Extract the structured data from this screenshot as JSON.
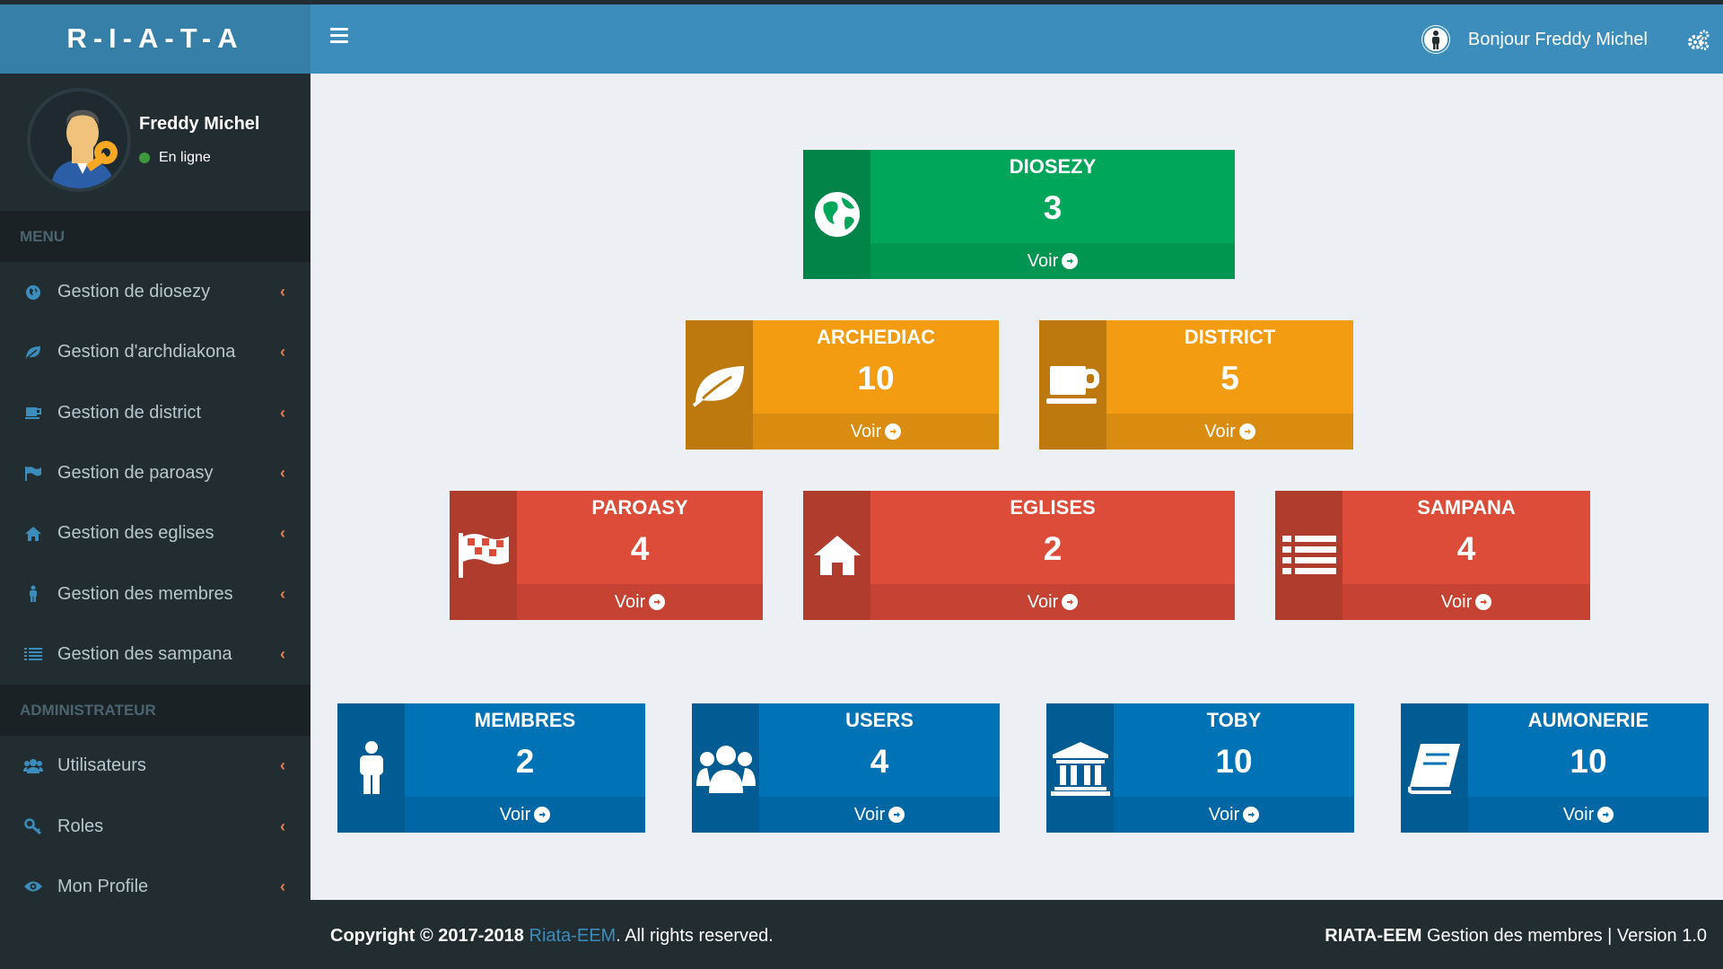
{
  "app": {
    "logo": "R-I-A-T-A"
  },
  "user": {
    "name": "Freddy Michel",
    "status": "En ligne"
  },
  "header": {
    "greeting": "Bonjour Freddy Michel"
  },
  "menu": {
    "section1": "MENU",
    "items": [
      {
        "label": "Gestion de diosezy",
        "icon": "globe-icon"
      },
      {
        "label": "Gestion d'archdiakona",
        "icon": "leaf-icon"
      },
      {
        "label": "Gestion de district",
        "icon": "coffee-icon"
      },
      {
        "label": "Gestion de paroasy",
        "icon": "flag-icon"
      },
      {
        "label": "Gestion des eglises",
        "icon": "home-icon"
      },
      {
        "label": "Gestion des membres",
        "icon": "male-icon"
      },
      {
        "label": "Gestion des sampana",
        "icon": "list-icon"
      }
    ],
    "section2": "ADMINISTRATEUR",
    "admin_items": [
      {
        "label": "Utilisateurs",
        "icon": "users-icon"
      },
      {
        "label": "Roles",
        "icon": "key-icon"
      },
      {
        "label": "Mon Profile",
        "icon": "eye-icon"
      }
    ]
  },
  "cards": [
    {
      "title": "DIOSEZY",
      "count": "3",
      "link": "Voir",
      "color": "#00a65a",
      "icon": "globe-icon"
    },
    {
      "title": "ARCHEDIAC",
      "count": "10",
      "link": "Voir",
      "color": "#f39c12",
      "icon": "leaf-icon"
    },
    {
      "title": "DISTRICT",
      "count": "5",
      "link": "Voir",
      "color": "#f39c12",
      "icon": "coffee-icon"
    },
    {
      "title": "PAROASY",
      "count": "4",
      "link": "Voir",
      "color": "#dd4b39",
      "icon": "flag-icon"
    },
    {
      "title": "EGLISES",
      "count": "2",
      "link": "Voir",
      "color": "#dd4b39",
      "icon": "home-icon"
    },
    {
      "title": "SAMPANA",
      "count": "4",
      "link": "Voir",
      "color": "#dd4b39",
      "icon": "list-icon"
    },
    {
      "title": "MEMBRES",
      "count": "2",
      "link": "Voir",
      "color": "#0073b7",
      "icon": "male-icon"
    },
    {
      "title": "USERS",
      "count": "4",
      "link": "Voir",
      "color": "#0073b7",
      "icon": "users-icon"
    },
    {
      "title": "TOBY",
      "count": "10",
      "link": "Voir",
      "color": "#0073b7",
      "icon": "institution-icon"
    },
    {
      "title": "AUMONERIE",
      "count": "10",
      "link": "Voir",
      "color": "#0073b7",
      "icon": "book-icon"
    }
  ],
  "footer": {
    "copyright": "Copyright © 2017-2018",
    "link": "Riata-EEM",
    "rights": ". All rights reserved.",
    "brand": "RIATA-EEM",
    "tail": "Gestion des membres | Version 1.0"
  }
}
